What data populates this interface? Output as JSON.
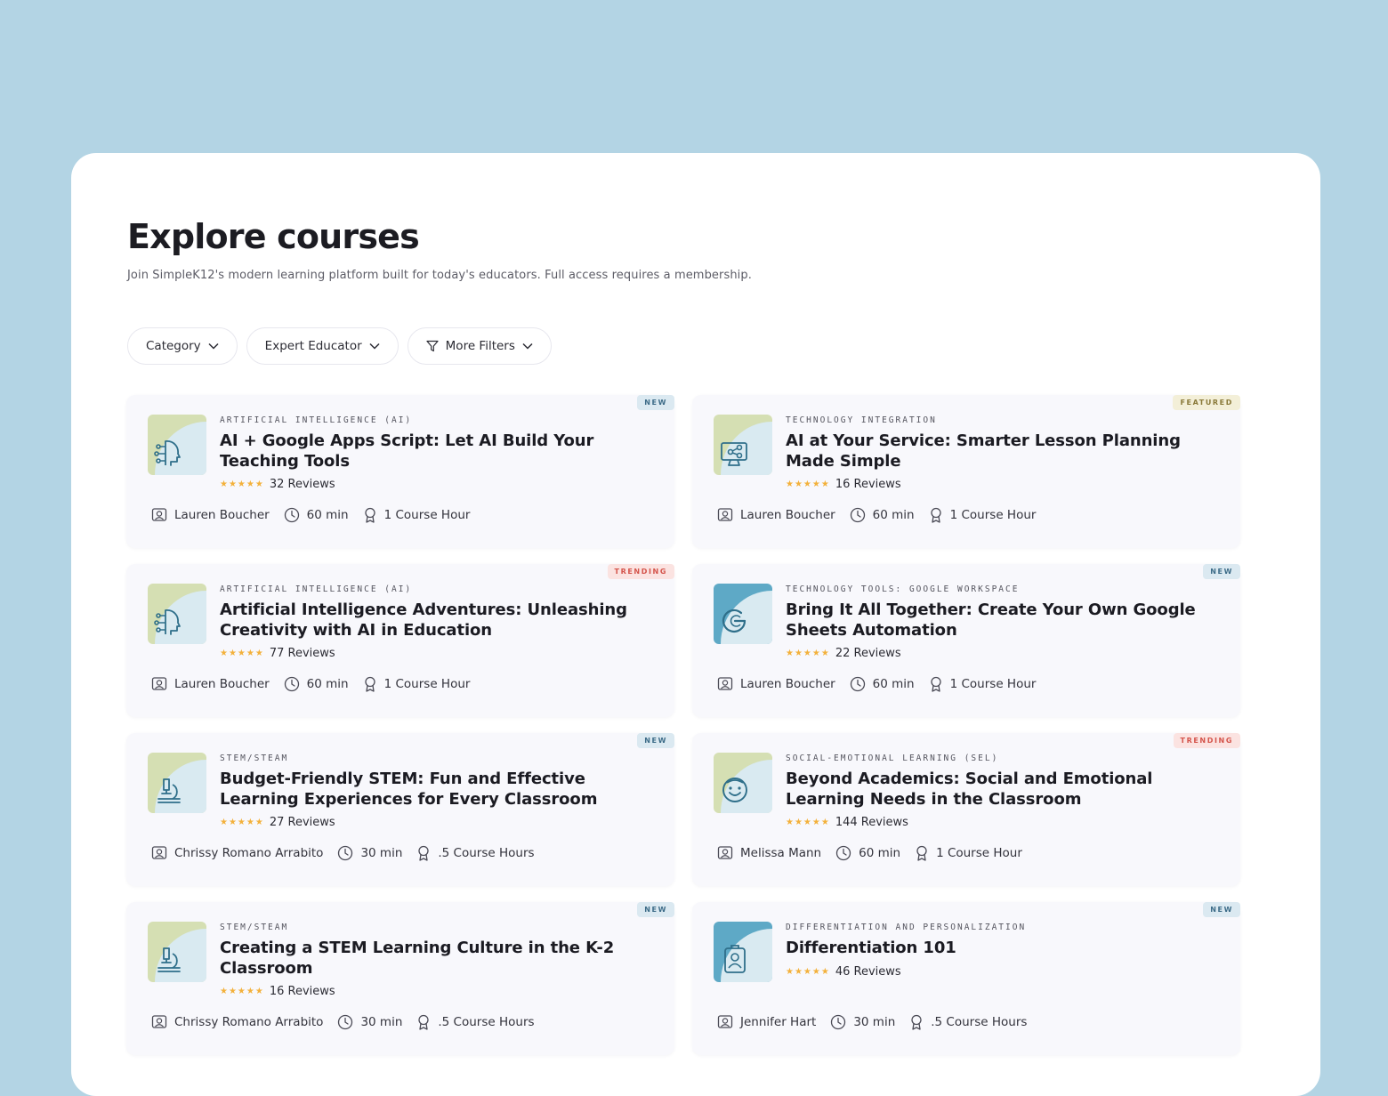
{
  "page": {
    "title": "Explore courses",
    "subtitle": "Join SimpleK12's modern learning platform built for today's educators. Full access requires a membership."
  },
  "filters": [
    {
      "label": "Category",
      "icon": "chevron-down-icon"
    },
    {
      "label": "Expert Educator",
      "icon": "chevron-down-icon"
    },
    {
      "label": "More Filters",
      "icon": "filter-icon"
    }
  ],
  "colors": {
    "background": "#b3d4e4",
    "card": "#f8f8fc",
    "star": "#f3b13b",
    "badge_new_bg": "#dbe9f1",
    "badge_new_text": "#3d6c88",
    "badge_featured_bg": "#f3efd8",
    "badge_featured_text": "#8a7a3a",
    "badge_trending_bg": "#fbe3e1",
    "badge_trending_text": "#d4544b",
    "thumb_green": "#d5dfb3",
    "thumb_blue": "#5ea9c6"
  },
  "courses": [
    {
      "badge": "NEW",
      "badge_type": "new",
      "category": "ARTIFICIAL INTELLIGENCE (AI)",
      "title": "AI + Google Apps Script: Let AI Build Your Teaching Tools",
      "stars": "★★★★★",
      "rating": 5,
      "reviews": "32 Reviews",
      "author": "Lauren Boucher",
      "duration": "60 min",
      "credit": "1 Course Hour",
      "thumb_color": "green",
      "icon": "ai-head-icon"
    },
    {
      "badge": "FEATURED",
      "badge_type": "featured",
      "category": "TECHNOLOGY INTEGRATION",
      "title": "AI at Your Service: Smarter Lesson Planning Made Simple",
      "stars": "★★★★★",
      "rating": 5,
      "reviews": "16 Reviews",
      "author": "Lauren Boucher",
      "duration": "60 min",
      "credit": "1 Course Hour",
      "thumb_color": "green",
      "icon": "computer-network-icon"
    },
    {
      "badge": "TRENDING",
      "badge_type": "trending",
      "category": "ARTIFICIAL INTELLIGENCE (AI)",
      "title": "Artificial Intelligence Adventures: Unleashing Creativity with AI in Education",
      "stars": "★★★★★",
      "rating": 5,
      "reviews": "77 Reviews",
      "author": "Lauren Boucher",
      "duration": "60 min",
      "credit": "1 Course Hour",
      "thumb_color": "green",
      "icon": "ai-head-icon"
    },
    {
      "badge": "NEW",
      "badge_type": "new",
      "category": "TECHNOLOGY TOOLS: GOOGLE WORKSPACE",
      "title": "Bring It All Together: Create Your Own Google Sheets Automation",
      "stars": "★★★★★",
      "rating": 5,
      "reviews": "22 Reviews",
      "author": "Lauren Boucher",
      "duration": "60 min",
      "credit": "1 Course Hour",
      "thumb_color": "blue",
      "icon": "google-g-icon"
    },
    {
      "badge": "NEW",
      "badge_type": "new",
      "category": "STEM/STEAM",
      "title": "Budget-Friendly STEM: Fun and Effective Learning Experiences for Every Classroom",
      "stars": "★★★★★",
      "rating": 5,
      "reviews": "27 Reviews",
      "author": "Chrissy Romano Arrabito",
      "duration": "30 min",
      "credit": ".5 Course Hours",
      "thumb_color": "green",
      "icon": "microscope-icon"
    },
    {
      "badge": "TRENDING",
      "badge_type": "trending",
      "category": "SOCIAL-EMOTIONAL LEARNING (SEL)",
      "title": "Beyond Academics: Social and Emotional Learning Needs in the Classroom",
      "stars": "★★★★★",
      "rating": 5,
      "reviews": "144 Reviews",
      "author": "Melissa Mann",
      "duration": "60 min",
      "credit": "1 Course Hour",
      "thumb_color": "green",
      "icon": "smiley-face-icon"
    },
    {
      "badge": "NEW",
      "badge_type": "new",
      "category": "STEM/STEAM",
      "title": "Creating a STEM Learning Culture in the K-2 Classroom",
      "stars": "★★★★★",
      "rating": 5,
      "reviews": "16 Reviews",
      "author": "Chrissy Romano Arrabito",
      "duration": "30 min",
      "credit": ".5 Course Hours",
      "thumb_color": "green",
      "icon": "microscope-icon"
    },
    {
      "badge": "NEW",
      "badge_type": "new",
      "category": "DIFFERENTIATION AND PERSONALIZATION",
      "title": "Differentiation 101",
      "stars": "★★★★★",
      "rating": 5,
      "reviews": "46 Reviews",
      "author": "Jennifer Hart",
      "duration": "30 min",
      "credit": ".5 Course Hours",
      "thumb_color": "blue",
      "icon": "id-badge-icon"
    }
  ]
}
